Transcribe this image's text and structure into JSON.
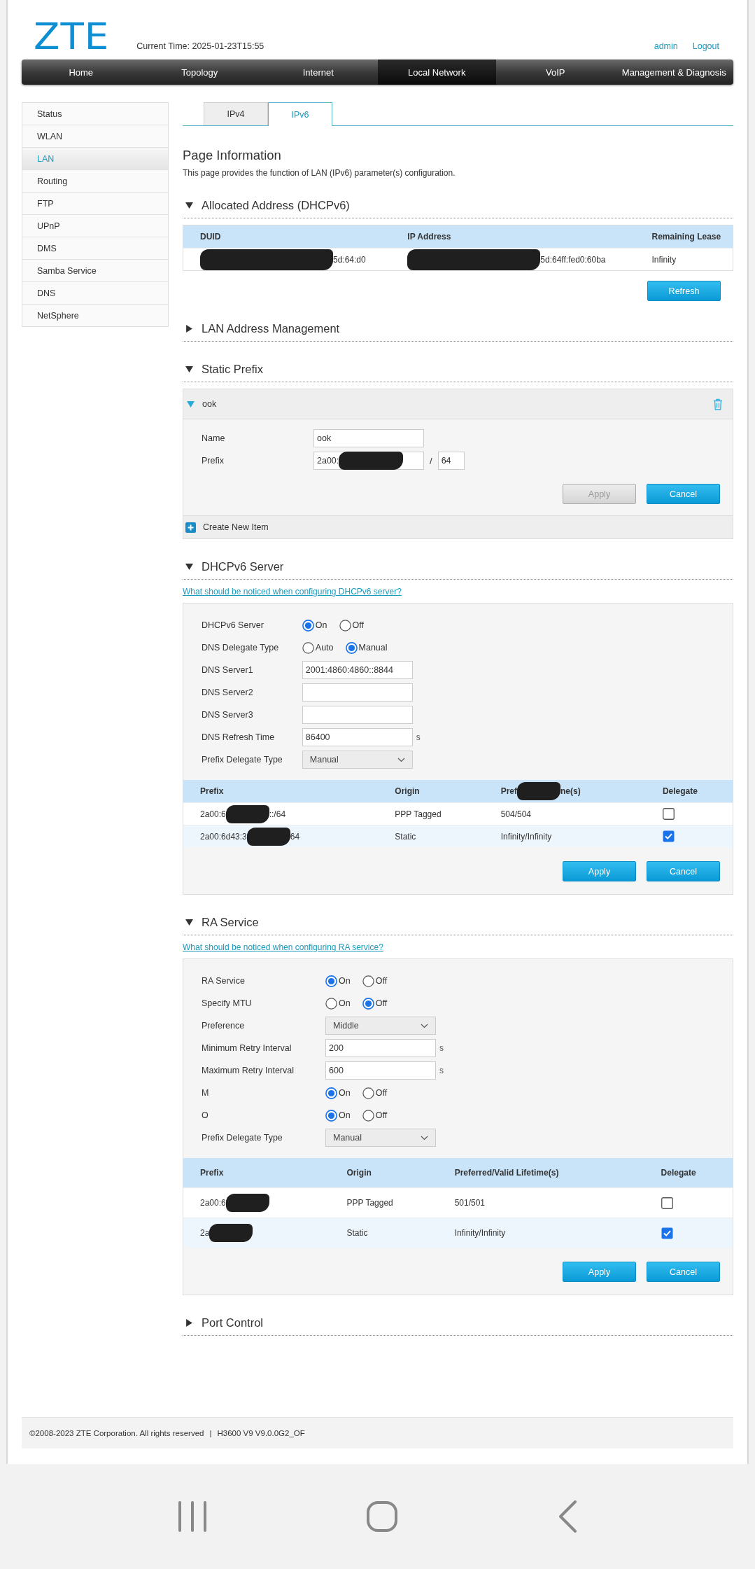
{
  "header": {
    "logo": "ZTE",
    "current_time": "Current Time: 2025-01-23T15:55",
    "links": [
      "admin",
      "Logout"
    ]
  },
  "nav": [
    {
      "label": "Home",
      "selected": false
    },
    {
      "label": "Topology",
      "selected": false
    },
    {
      "label": "Internet",
      "selected": false
    },
    {
      "label": "Local Network",
      "selected": true
    },
    {
      "label": "VoIP",
      "selected": false
    },
    {
      "label": "Management & Diagnosis",
      "selected": false
    }
  ],
  "sidebar": [
    {
      "label": "Status",
      "selected": false
    },
    {
      "label": "WLAN",
      "selected": false
    },
    {
      "label": "LAN",
      "selected": true
    },
    {
      "label": "Routing",
      "selected": false
    },
    {
      "label": "FTP",
      "selected": false
    },
    {
      "label": "UPnP",
      "selected": false
    },
    {
      "label": "DMS",
      "selected": false
    },
    {
      "label": "Samba Service",
      "selected": false
    },
    {
      "label": "DNS",
      "selected": false
    },
    {
      "label": "NetSphere",
      "selected": false
    }
  ],
  "tabs": [
    {
      "label": "IPv4",
      "selected": false
    },
    {
      "label": "IPv6",
      "selected": true
    }
  ],
  "page_info": {
    "title": "Page Information",
    "text": "This page provides the function of LAN (IPv6) parameter(s) configuration."
  },
  "sections": [
    {
      "kind": "table",
      "title": "Allocated Address (DHCPv6)",
      "expanded": true,
      "table": {
        "columns": [
          {
            "text": "DUID"
          },
          {
            "text": "IP Address"
          },
          {
            "text": "Remaining Lease"
          }
        ],
        "rows": [
          [
            {
              "redacted": true,
              "after": "5d:64:d0"
            },
            {
              "redacted": true,
              "after": "5d:64ff:fed0:60ba"
            },
            {
              "text": "Infinity"
            }
          ]
        ]
      },
      "buttons": [
        {
          "label": "Refresh",
          "disabled": false
        }
      ]
    },
    {
      "kind": "collapsed",
      "title": "LAN Address Management",
      "expanded": false
    },
    {
      "kind": "static_prefix",
      "title": "Static Prefix",
      "expanded": true,
      "entries": [
        {
          "name": "ook",
          "expanded": true,
          "fields": [
            {
              "kind": "input",
              "label": "Name",
              "value": "ook"
            },
            {
              "kind": "prefix",
              "label": "Prefix",
              "value": "2a00:",
              "redacted": true,
              "separator": "/",
              "length": "64"
            }
          ],
          "buttons": [
            {
              "label": "Apply",
              "disabled": true
            },
            {
              "label": "Cancel",
              "disabled": false
            }
          ]
        }
      ],
      "create_label": "Create New Item"
    },
    {
      "kind": "form",
      "title": "DHCPv6 Server",
      "expanded": true,
      "help_link": "What should be noticed when configuring DHCPv6 server?",
      "fields": [
        {
          "kind": "radio",
          "label": "DHCPv6 Server",
          "options": [
            {
              "label": "On",
              "selected": true
            },
            {
              "label": "Off",
              "selected": false
            }
          ]
        },
        {
          "kind": "radio",
          "label": "DNS Delegate Type",
          "options": [
            {
              "label": "Auto",
              "selected": false
            },
            {
              "label": "Manual",
              "selected": true
            }
          ]
        },
        {
          "kind": "input",
          "label": "DNS Server1",
          "value": "2001:4860:4860::8844"
        },
        {
          "kind": "input",
          "label": "DNS Server2"
        },
        {
          "kind": "input",
          "label": "DNS Server3"
        },
        {
          "kind": "input",
          "label": "DNS Refresh Time",
          "value": "86400",
          "unit": "s"
        },
        {
          "kind": "select",
          "label": "Prefix Delegate Type",
          "value": "Manual"
        }
      ],
      "table": {
        "columns": [
          {
            "text": "Prefix"
          },
          {
            "text": "Origin"
          },
          {
            "before": "Pref",
            "redacted": true,
            "after": "ne(s)"
          },
          {
            "text": "Delegate"
          }
        ],
        "rows": [
          [
            {
              "before": "2a00:6",
              "redacted": true,
              "after": "::/64"
            },
            {
              "text": "PPP Tagged"
            },
            {
              "text": "504/504"
            },
            {
              "kind": "checkbox",
              "checked": false
            }
          ],
          [
            {
              "before": "2a00:6d43:3",
              "redacted": true,
              "after": "64"
            },
            {
              "text": "Static"
            },
            {
              "text": "Infinity/Infinity"
            },
            {
              "kind": "checkbox",
              "checked": true
            }
          ]
        ]
      },
      "buttons": [
        {
          "label": "Apply",
          "disabled": false
        },
        {
          "label": "Cancel",
          "disabled": false
        }
      ]
    },
    {
      "kind": "form",
      "title": "RA Service",
      "expanded": true,
      "help_link": "What should be noticed when configuring RA service?",
      "fields": [
        {
          "kind": "radio",
          "label": "RA Service",
          "options": [
            {
              "label": "On",
              "selected": true
            },
            {
              "label": "Off",
              "selected": false
            }
          ]
        },
        {
          "kind": "radio",
          "label": "Specify MTU",
          "options": [
            {
              "label": "On",
              "selected": false
            },
            {
              "label": "Off",
              "selected": true
            }
          ]
        },
        {
          "kind": "select",
          "label": "Preference",
          "value": "Middle"
        },
        {
          "kind": "input",
          "label": "Minimum Retry Interval",
          "value": "200",
          "unit": "s"
        },
        {
          "kind": "input",
          "label": "Maximum Retry Interval",
          "value": "600",
          "unit": "s"
        },
        {
          "kind": "radio",
          "label": "M",
          "options": [
            {
              "label": "On",
              "selected": true
            },
            {
              "label": "Off",
              "selected": false
            }
          ]
        },
        {
          "kind": "radio",
          "label": "O",
          "options": [
            {
              "label": "On",
              "selected": true
            },
            {
              "label": "Off",
              "selected": false
            }
          ]
        },
        {
          "kind": "select",
          "label": "Prefix Delegate Type",
          "value": "Manual"
        }
      ],
      "table": {
        "columns": [
          {
            "text": "Prefix"
          },
          {
            "text": "Origin"
          },
          {
            "text": "Preferred/Valid Lifetime(s)"
          },
          {
            "text": "Delegate"
          }
        ],
        "rows": [
          [
            {
              "before": "2a00:6",
              "redacted": true
            },
            {
              "text": "PPP Tagged"
            },
            {
              "text": "501/501"
            },
            {
              "kind": "checkbox",
              "checked": false
            }
          ],
          [
            {
              "before": "2a",
              "redacted": true
            },
            {
              "text": "Static"
            },
            {
              "text": "Infinity/Infinity"
            },
            {
              "kind": "checkbox",
              "checked": true
            }
          ]
        ]
      },
      "buttons": [
        {
          "label": "Apply",
          "disabled": false
        },
        {
          "label": "Cancel",
          "disabled": false
        }
      ]
    },
    {
      "kind": "collapsed",
      "title": "Port Control",
      "expanded": false
    }
  ],
  "footer": {
    "copyright": "©2008-2023 ZTE Corporation. All rights reserved",
    "separator": "|",
    "version": "H3600 V9 V9.0.0G2_OF"
  }
}
